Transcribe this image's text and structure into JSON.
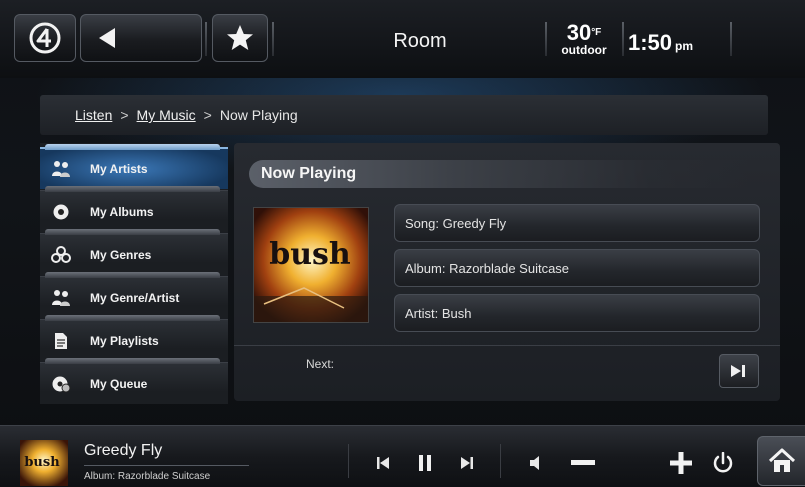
{
  "topbar": {
    "room": "Room",
    "temperature": "30",
    "temperature_unit": "°F",
    "temperature_note": "outdoor",
    "time": "1:50",
    "ampm": "pm",
    "icons": [
      "control4-logo-icon",
      "back-arrow-icon",
      "star-icon"
    ]
  },
  "breadcrumb": {
    "items": [
      "Listen",
      "My Music",
      "Now Playing"
    ],
    "separator": ">"
  },
  "sidebar": {
    "items": [
      {
        "label": "My Artists",
        "icon": "artists-icon",
        "active": true
      },
      {
        "label": "My Albums",
        "icon": "album-disc-icon",
        "active": false
      },
      {
        "label": "My Genres",
        "icon": "genres-icon",
        "active": false
      },
      {
        "label": "My Genre/Artist",
        "icon": "genre-artist-icon",
        "active": false
      },
      {
        "label": "My Playlists",
        "icon": "playlist-document-icon",
        "active": false
      },
      {
        "label": "My Queue",
        "icon": "queue-disc-icon",
        "active": false
      }
    ]
  },
  "now_playing": {
    "header": "Now Playing",
    "song": "Song: Greedy Fly",
    "album": "Album: Razorblade Suitcase",
    "artist": "Artist: Bush",
    "next_label": "Next:",
    "album_art_logo": "bush"
  },
  "bottombar": {
    "song": "Greedy Fly",
    "album": "Album: Razorblade Suitcase",
    "controls": [
      "previous-icon",
      "pause-icon",
      "next-icon",
      "volume-icon",
      "volume-down-icon",
      "volume-up-icon",
      "power-icon",
      "home-icon"
    ]
  },
  "colors": {
    "active_item": "#3b78b8",
    "background": "#0d0f12"
  }
}
